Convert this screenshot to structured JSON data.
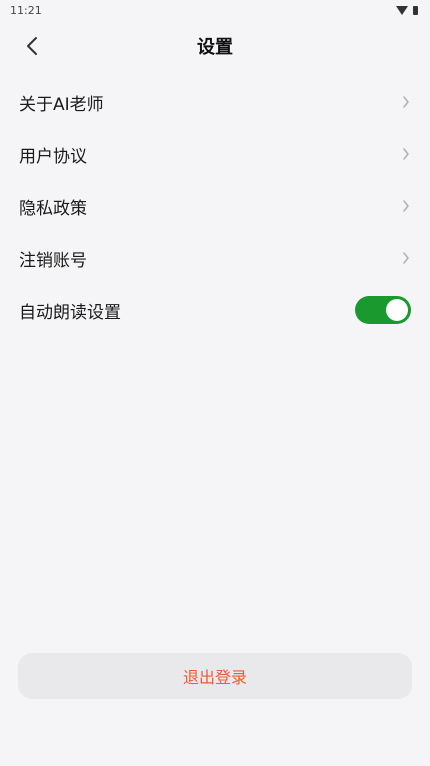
{
  "status_bar": {
    "time": "11:21",
    "wifi_icon": "wifi-icon",
    "battery_icon": "battery-icon"
  },
  "nav": {
    "title": "设置",
    "back_icon": "chevron-left-icon"
  },
  "settings": {
    "items": [
      {
        "label": "关于AI老师"
      },
      {
        "label": "用户协议"
      },
      {
        "label": "隐私政策"
      },
      {
        "label": "注销账号"
      }
    ],
    "auto_read": {
      "label": "自动朗读设置",
      "enabled": true
    }
  },
  "logout": {
    "label": "退出登录"
  },
  "colors": {
    "toggle_on": "#1a9a2e",
    "logout_text": "#f05a32",
    "chevron": "#b0b0b0",
    "background": "#f5f5f7"
  }
}
